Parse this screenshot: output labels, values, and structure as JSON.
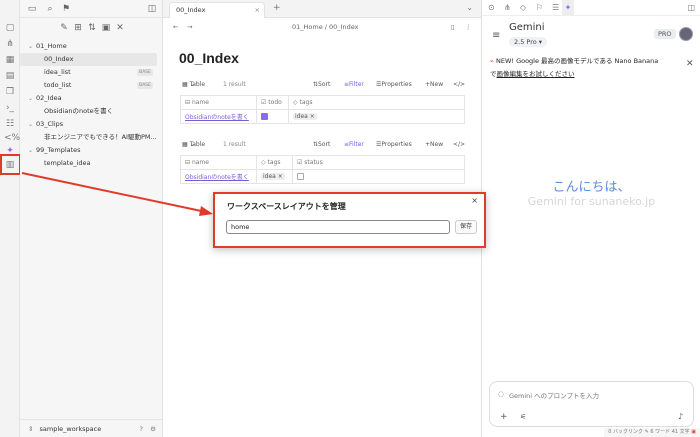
{
  "sidebar": {
    "tree": [
      {
        "label": "01_Home",
        "level": 0,
        "chev": "v"
      },
      {
        "label": "00_Index",
        "level": 1,
        "active": true
      },
      {
        "label": "idea_list",
        "level": 1,
        "badge": "BASE"
      },
      {
        "label": "todo_list",
        "level": 1,
        "badge": "BASE"
      },
      {
        "label": "02_Idea",
        "level": 0,
        "chev": "v"
      },
      {
        "label": "Obsidianのnoteを書く",
        "level": 1
      },
      {
        "label": "03_Clips",
        "level": 0,
        "chev": "v"
      },
      {
        "label": "非エンジニアでもできる！AI駆動PM...",
        "level": 1
      },
      {
        "label": "99_Templates",
        "level": 0,
        "chev": "v"
      },
      {
        "label": "template_idea",
        "level": 1
      }
    ],
    "workspace": "sample_workspace"
  },
  "main": {
    "tab_title": "00_Index",
    "breadcrumb": "01_Home / 00_Index",
    "title": "00_Index",
    "base1": {
      "view": "Table",
      "count": "1 result",
      "sort": "Sort",
      "filter": "Filter",
      "properties": "Properties",
      "new": "New",
      "headers": [
        "name",
        "todo",
        "tags"
      ],
      "row": {
        "name": "Obsidianのnoteを書く",
        "todo": true,
        "tag": "idea"
      }
    },
    "base2": {
      "view": "Table",
      "count": "1 result",
      "sort": "Sort",
      "filter": "Filter",
      "properties": "Properties",
      "new": "New",
      "headers": [
        "name",
        "tags",
        "status"
      ],
      "row": {
        "name": "Obsidianのnoteを書く",
        "tag": "idea",
        "status": false
      }
    }
  },
  "gemini": {
    "title": "Gemini",
    "model": "2.5 Pro",
    "pro_badge": "PRO",
    "banner_line1": "NEW! Google 最高の画像モデルである Nano Banana",
    "banner_line2_pre": "で",
    "banner_line2_link": "画像編集をお試しください",
    "greeting": "こんにちは、",
    "greeting_sub": "Gemini for sunaneko.jp",
    "prompt_placeholder": "Gemini へのプロンプトを入力"
  },
  "modal": {
    "title": "ワークスペースレイアウトを管理",
    "input_value": "home",
    "save_label": "保存"
  },
  "statusbar": {
    "backlinks": "0 バックリンク",
    "words": "6 ワード",
    "chars": "41 文字"
  },
  "colors": {
    "accent": "#8b6cf0",
    "highlight": "#e23a2a",
    "link": "#7b5cd6"
  }
}
